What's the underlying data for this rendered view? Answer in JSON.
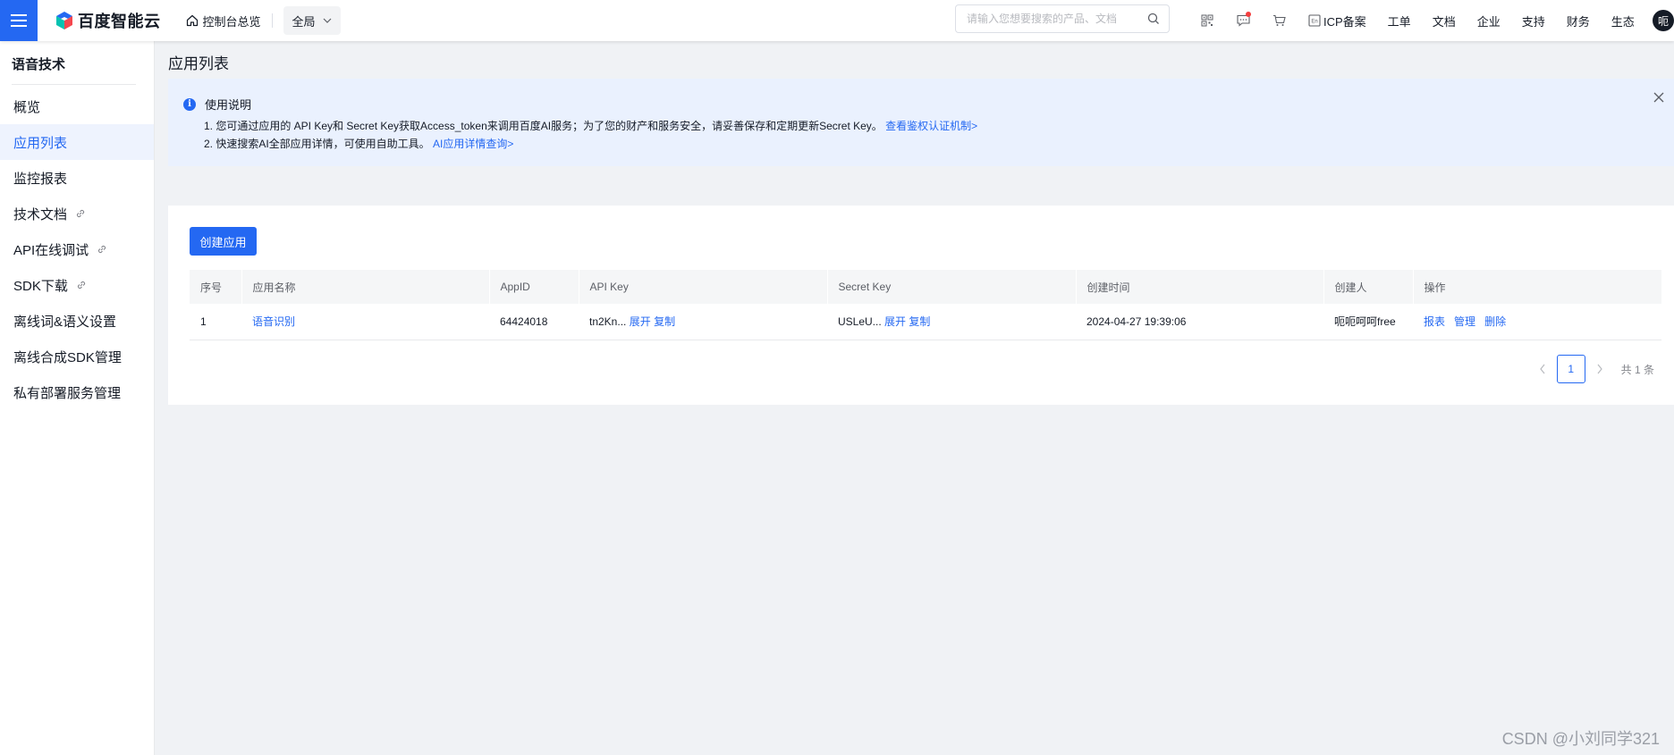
{
  "topbar": {
    "logo_text": "百度智能云",
    "home_label": "控制台总览",
    "region_label": "全局",
    "search_placeholder": "请输入您想要搜索的产品、文档",
    "icons": [
      "qrcode-icon",
      "message-icon",
      "cart-icon",
      "language-icon"
    ],
    "nav": [
      "ICP备案",
      "工单",
      "文档",
      "企业",
      "支持",
      "财务",
      "生态"
    ],
    "avatar_text": "呃"
  },
  "sidebar": {
    "title": "语音技术",
    "items": [
      {
        "label": "概览"
      },
      {
        "label": "应用列表"
      },
      {
        "label": "监控报表"
      },
      {
        "label": "技术文档"
      },
      {
        "label": "API在线调试"
      },
      {
        "label": "SDK下载"
      },
      {
        "label": "离线词&语义设置"
      },
      {
        "label": "离线合成SDK管理"
      },
      {
        "label": "私有部署服务管理"
      }
    ],
    "active_index": 1
  },
  "main": {
    "title": "应用列表",
    "notice": {
      "title": "使用说明",
      "line1_text": "1. 您可通过应用的 API Key和 Secret Key获取Access_token来调用百度AI服务；为了您的财产和服务安全，请妥善保存和定期更新Secret Key。",
      "line1_link": "查看鉴权认证机制>",
      "line2_text": "2. 快速搜索AI全部应用详情，可使用自助工具。",
      "line2_link": "AI应用详情查询>"
    },
    "create_button": "创建应用",
    "table": {
      "headers": [
        "序号",
        "应用名称",
        "AppID",
        "API Key",
        "Secret Key",
        "创建时间",
        "创建人",
        "操作"
      ],
      "rows": [
        {
          "index": "1",
          "name": "语音识别",
          "appid": "64424018",
          "api_key": "tn2Kn...",
          "secret_key": "USLeU...",
          "expand": "展开",
          "copy": "复制",
          "created": "2024-04-27 19:39:06",
          "creator": "呃呃呵呵free",
          "actions": [
            "报表",
            "管理",
            "删除"
          ]
        }
      ]
    },
    "pagination": {
      "current": "1",
      "total_text": "共 1 条"
    }
  },
  "watermark": "CSDN @小刘同学321",
  "colors": {
    "primary": "#2468f2",
    "notice_bg": "#eaf1fe",
    "active_bg": "#eef3fe"
  }
}
